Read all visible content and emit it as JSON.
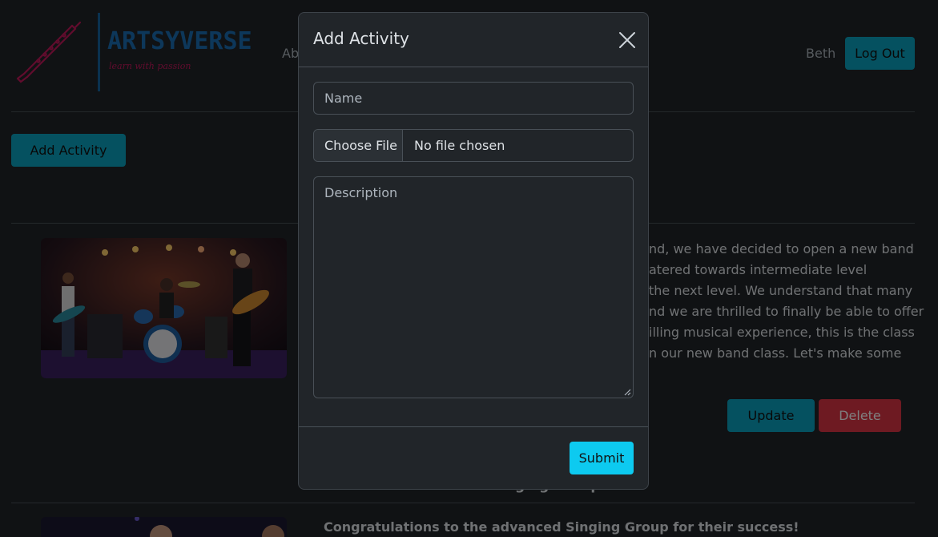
{
  "navbar": {
    "logo_title": "ARTSYVERSE",
    "logo_tagline": "learn with passion",
    "nav_link_partial": "Ab",
    "user_name": "Beth",
    "logout_label": "Log Out"
  },
  "main": {
    "add_activity_label": "Add Activity",
    "activities": [
      {
        "description_lines": [
          "nd, we have decided to open a new band",
          "atered towards intermediate level",
          "the next level. We understand that many",
          "nd we are thrilled to finally be able to offer",
          "illing musical experience, this is the class",
          "n our new band class. Let's make some"
        ],
        "update_label": "Update",
        "delete_label": "Delete"
      },
      {
        "title_partial": "Success of the Singing Group",
        "description": "Congratulations to the advanced Singing Group for their success!"
      }
    ]
  },
  "modal": {
    "title": "Add Activity",
    "name_placeholder": "Name",
    "file_button_label": "Choose File",
    "file_status": "No file chosen",
    "description_placeholder": "Description",
    "submit_label": "Submit"
  },
  "colors": {
    "accent": "#0aa2c0",
    "submit": "#0dcaf0",
    "danger": "#dc3545",
    "background": "#212529",
    "logo_blue": "#1a6fb5",
    "logo_pink": "#c2185b"
  },
  "icons": {
    "logo": "clarinet-icon",
    "close": "close-icon",
    "resize": "resize-handle-icon"
  }
}
